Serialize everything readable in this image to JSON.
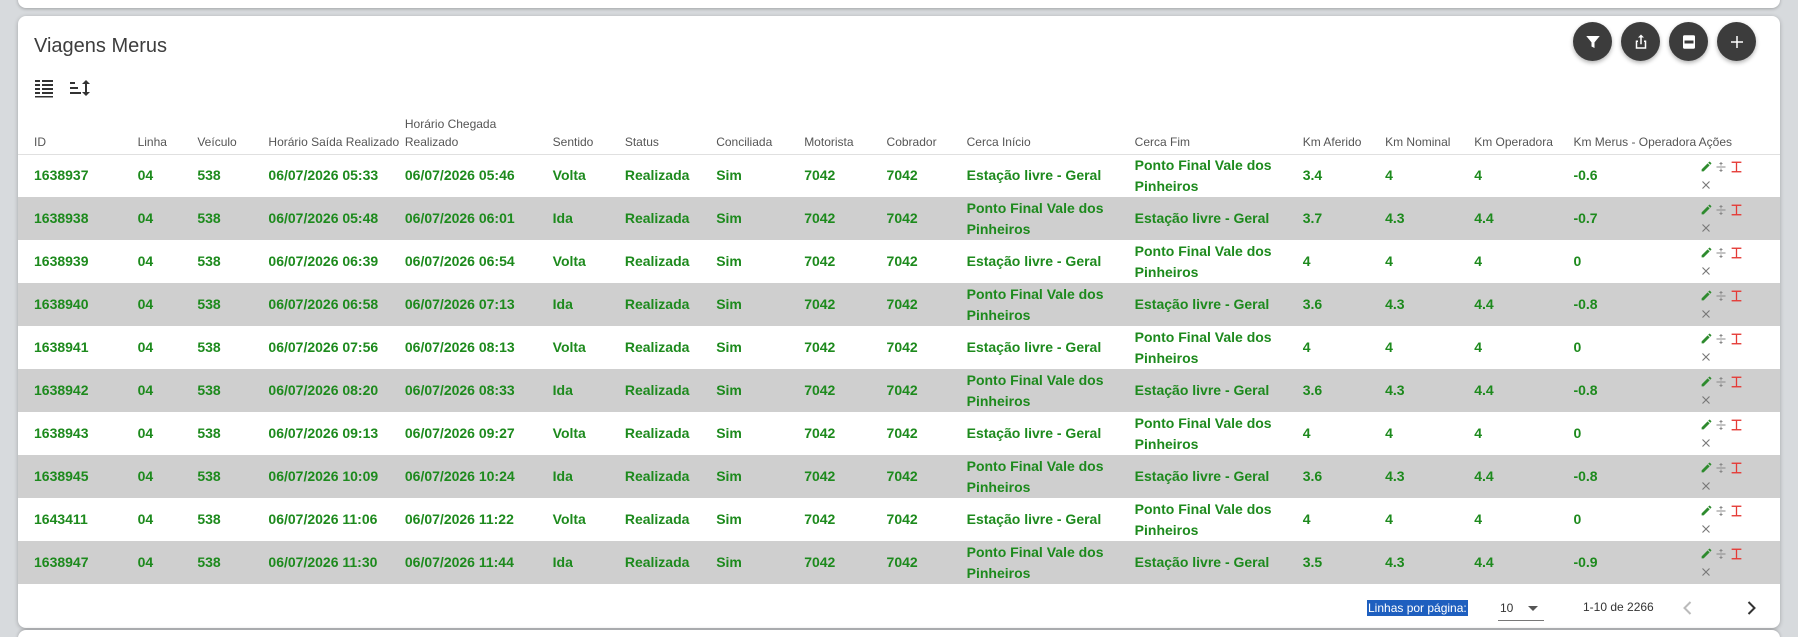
{
  "title": "Viagens Merus",
  "columns": [
    "ID",
    "Linha",
    "Veículo",
    "Horário Saída Realizado",
    "Horário Chegada Realizado",
    "Sentido",
    "Status",
    "Conciliada",
    "Motorista",
    "Cobrador",
    "Cerca Início",
    "Cerca Fim",
    "Km Aferido",
    "Km Nominal",
    "Km Operadora",
    "Km Merus - Operadora",
    "Ações"
  ],
  "rows": [
    {
      "id": "1638937",
      "linha": "04",
      "veiculo": "538",
      "saida": "06/07/2026 05:33",
      "chegada": "06/07/2026 05:46",
      "sentido": "Volta",
      "status": "Realizada",
      "conciliada": "Sim",
      "motorista": "7042",
      "cobrador": "7042",
      "cerca_inicio": "Estação livre - Geral",
      "cerca_fim": "Ponto Final Vale dos Pinheiros",
      "km_aferido": "3.4",
      "km_nominal": "4",
      "km_operadora": "4",
      "km_diff": "-0.6"
    },
    {
      "id": "1638938",
      "linha": "04",
      "veiculo": "538",
      "saida": "06/07/2026 05:48",
      "chegada": "06/07/2026 06:01",
      "sentido": "Ida",
      "status": "Realizada",
      "conciliada": "Sim",
      "motorista": "7042",
      "cobrador": "7042",
      "cerca_inicio": "Ponto Final Vale dos Pinheiros",
      "cerca_fim": "Estação livre - Geral",
      "km_aferido": "3.7",
      "km_nominal": "4.3",
      "km_operadora": "4.4",
      "km_diff": "-0.7"
    },
    {
      "id": "1638939",
      "linha": "04",
      "veiculo": "538",
      "saida": "06/07/2026 06:39",
      "chegada": "06/07/2026 06:54",
      "sentido": "Volta",
      "status": "Realizada",
      "conciliada": "Sim",
      "motorista": "7042",
      "cobrador": "7042",
      "cerca_inicio": "Estação livre - Geral",
      "cerca_fim": "Ponto Final Vale dos Pinheiros",
      "km_aferido": "4",
      "km_nominal": "4",
      "km_operadora": "4",
      "km_diff": "0"
    },
    {
      "id": "1638940",
      "linha": "04",
      "veiculo": "538",
      "saida": "06/07/2026 06:58",
      "chegada": "06/07/2026 07:13",
      "sentido": "Ida",
      "status": "Realizada",
      "conciliada": "Sim",
      "motorista": "7042",
      "cobrador": "7042",
      "cerca_inicio": "Ponto Final Vale dos Pinheiros",
      "cerca_fim": "Estação livre - Geral",
      "km_aferido": "3.6",
      "km_nominal": "4.3",
      "km_operadora": "4.4",
      "km_diff": "-0.8"
    },
    {
      "id": "1638941",
      "linha": "04",
      "veiculo": "538",
      "saida": "06/07/2026 07:56",
      "chegada": "06/07/2026 08:13",
      "sentido": "Volta",
      "status": "Realizada",
      "conciliada": "Sim",
      "motorista": "7042",
      "cobrador": "7042",
      "cerca_inicio": "Estação livre - Geral",
      "cerca_fim": "Ponto Final Vale dos Pinheiros",
      "km_aferido": "4",
      "km_nominal": "4",
      "km_operadora": "4",
      "km_diff": "0"
    },
    {
      "id": "1638942",
      "linha": "04",
      "veiculo": "538",
      "saida": "06/07/2026 08:20",
      "chegada": "06/07/2026 08:33",
      "sentido": "Ida",
      "status": "Realizada",
      "conciliada": "Sim",
      "motorista": "7042",
      "cobrador": "7042",
      "cerca_inicio": "Ponto Final Vale dos Pinheiros",
      "cerca_fim": "Estação livre - Geral",
      "km_aferido": "3.6",
      "km_nominal": "4.3",
      "km_operadora": "4.4",
      "km_diff": "-0.8"
    },
    {
      "id": "1638943",
      "linha": "04",
      "veiculo": "538",
      "saida": "06/07/2026 09:13",
      "chegada": "06/07/2026 09:27",
      "sentido": "Volta",
      "status": "Realizada",
      "conciliada": "Sim",
      "motorista": "7042",
      "cobrador": "7042",
      "cerca_inicio": "Estação livre - Geral",
      "cerca_fim": "Ponto Final Vale dos Pinheiros",
      "km_aferido": "4",
      "km_nominal": "4",
      "km_operadora": "4",
      "km_diff": "0"
    },
    {
      "id": "1638945",
      "linha": "04",
      "veiculo": "538",
      "saida": "06/07/2026 10:09",
      "chegada": "06/07/2026 10:24",
      "sentido": "Ida",
      "status": "Realizada",
      "conciliada": "Sim",
      "motorista": "7042",
      "cobrador": "7042",
      "cerca_inicio": "Ponto Final Vale dos Pinheiros",
      "cerca_fim": "Estação livre - Geral",
      "km_aferido": "3.6",
      "km_nominal": "4.3",
      "km_operadora": "4.4",
      "km_diff": "-0.8"
    },
    {
      "id": "1643411",
      "linha": "04",
      "veiculo": "538",
      "saida": "06/07/2026 11:06",
      "chegada": "06/07/2026 11:22",
      "sentido": "Volta",
      "status": "Realizada",
      "conciliada": "Sim",
      "motorista": "7042",
      "cobrador": "7042",
      "cerca_inicio": "Estação livre - Geral",
      "cerca_fim": "Ponto Final Vale dos Pinheiros",
      "km_aferido": "4",
      "km_nominal": "4",
      "km_operadora": "4",
      "km_diff": "0"
    },
    {
      "id": "1638947",
      "linha": "04",
      "veiculo": "538",
      "saida": "06/07/2026 11:30",
      "chegada": "06/07/2026 11:44",
      "sentido": "Ida",
      "status": "Realizada",
      "conciliada": "Sim",
      "motorista": "7042",
      "cobrador": "7042",
      "cerca_inicio": "Ponto Final Vale dos Pinheiros",
      "cerca_fim": "Estação livre - Geral",
      "km_aferido": "3.5",
      "km_nominal": "4.3",
      "km_operadora": "4.4",
      "km_diff": "-0.9"
    }
  ],
  "footer": {
    "rows_per_page_label": "Linhas por página:",
    "rows_per_page_value": "10",
    "range": "1-10 de 2266"
  },
  "icons": {
    "fabs": [
      "filter-icon",
      "share-icon",
      "pdf-icon",
      "plus-icon"
    ],
    "row_actions": [
      "edit-icon",
      "split-icon",
      "text-cursor-icon",
      "close-icon"
    ]
  },
  "colors": {
    "row_text": "#1d8a1d",
    "alt_row_bg": "#cfcfcf",
    "fab_bg": "#3c3c3c",
    "edit_icon": "#2e8b2e",
    "danger_icon": "#e53935",
    "selection": "#1e5fbf"
  }
}
